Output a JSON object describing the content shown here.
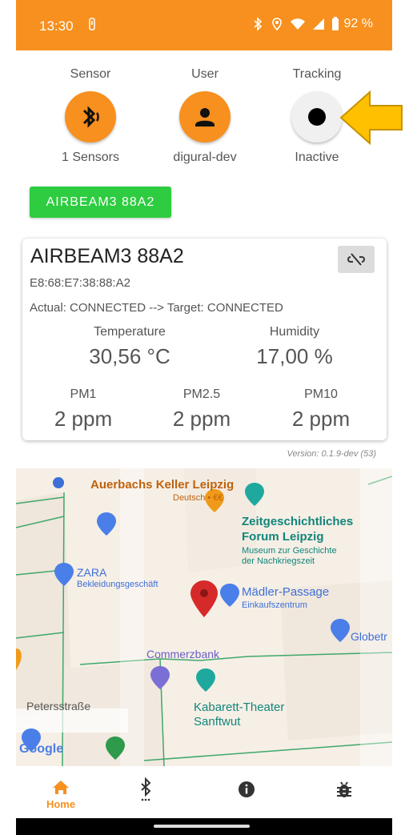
{
  "status_bar": {
    "time": "13:30",
    "battery": "92 %",
    "bg_color": "#f7901e"
  },
  "header": {
    "sensor": {
      "label": "Sensor",
      "value": "1 Sensors",
      "icon": "bluetooth-audio-icon"
    },
    "user": {
      "label": "User",
      "value": "digural-dev",
      "icon": "person-icon"
    },
    "tracking": {
      "label": "Tracking",
      "value": "Inactive",
      "icon": "record-icon"
    }
  },
  "device_button": {
    "label": "AIRBEAM3 88A2",
    "color": "#2ecc40"
  },
  "device_card": {
    "title": "AIRBEAM3 88A2",
    "mac": "E8:68:E7:38:88:A2",
    "connection": "Actual: CONNECTED --> Target: CONNECTED",
    "metrics_top": [
      {
        "label": "Temperature",
        "value": "30,56 °C"
      },
      {
        "label": "Humidity",
        "value": "17,00  %"
      }
    ],
    "metrics_bottom": [
      {
        "label": "PM1",
        "value": "2 ppm"
      },
      {
        "label": "PM2.5",
        "value": "2 ppm"
      },
      {
        "label": "PM10",
        "value": "2 ppm"
      }
    ]
  },
  "version": "Version: 0.1.9-dev (53)",
  "map": {
    "labels": {
      "auerbachs": "Auerbachs Keller Leipzig",
      "auerbachs_sub": "Deutsch • €€",
      "zeitgeschichtliches_1": "Zeitgeschichtliches",
      "zeitgeschichtliches_2": "Forum Leipzig",
      "museum_1": "Museum zur Geschichte",
      "museum_2": "der Nachkriegszeit",
      "zara": "ZARA",
      "zara_sub": "Bekleidungsgeschäft",
      "maedler": "Mädler-Passage",
      "maedler_sub": "Einkaufszentrum",
      "globetr": "Globetr",
      "commerzbank": "Commerzbank",
      "petersstrasse": "Petersstraße",
      "kabarett_1": "Kabarett-Theater",
      "kabarett_2": "Sanftwut",
      "google": "Google"
    }
  },
  "bottom_nav": {
    "items": [
      {
        "label": "Home",
        "icon": "home-icon"
      },
      {
        "label": "",
        "icon": "bluetooth-searching-icon"
      },
      {
        "label": "",
        "icon": "info-icon"
      },
      {
        "label": "",
        "icon": "bug-icon"
      }
    ],
    "active_color": "#f7901e"
  }
}
